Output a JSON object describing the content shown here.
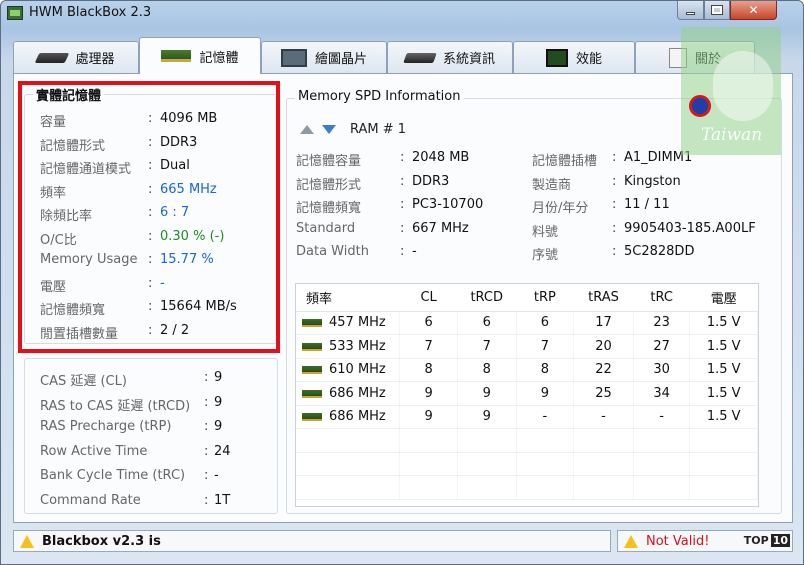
{
  "window": {
    "title": "HWM BlackBox 2.3"
  },
  "tabs": [
    {
      "label": "處理器",
      "icon": "cpu-icon"
    },
    {
      "label": "記憶體",
      "icon": "memory-icon"
    },
    {
      "label": "繪圖晶片",
      "icon": "gpu-icon"
    },
    {
      "label": "系統資訊",
      "icon": "system-info-icon"
    },
    {
      "label": "效能",
      "icon": "performance-icon"
    },
    {
      "label": "關於",
      "icon": "about-icon"
    }
  ],
  "physical_memory": {
    "title": "實體記憶體",
    "rows": [
      {
        "label": "容量",
        "value": "4096 MB",
        "color": "normal"
      },
      {
        "label": "記憶體形式",
        "value": "DDR3",
        "color": "normal"
      },
      {
        "label": "記憶體通道模式",
        "value": "Dual",
        "color": "normal"
      },
      {
        "label": "頻率",
        "value": "665 MHz",
        "color": "blue"
      },
      {
        "label": "除頻比率",
        "value": "6 : 7",
        "color": "blue"
      },
      {
        "label": "O/C比",
        "value": "0.30 % (-)",
        "color": "green"
      },
      {
        "label": "Memory Usage",
        "value": "15.77 %",
        "color": "blue"
      },
      {
        "label": "電壓",
        "value": "-",
        "color": "blue"
      },
      {
        "label": "記憶體頻寬",
        "value": "15664 MB/s",
        "color": "normal"
      },
      {
        "label": "閒置插槽數量",
        "value": "2  /  2",
        "color": "normal"
      }
    ]
  },
  "timings": {
    "rows": [
      {
        "label": "CAS 延遲 (CL)",
        "value": "9"
      },
      {
        "label": "RAS to CAS 延遲 (tRCD)",
        "value": "9"
      },
      {
        "label": "RAS Precharge (tRP)",
        "value": "9"
      },
      {
        "label": "Row Active Time",
        "value": "24"
      },
      {
        "label": "Bank Cycle Time (tRC)",
        "value": "-"
      },
      {
        "label": "Command Rate",
        "value": "1T"
      }
    ]
  },
  "spd": {
    "title": "Memory SPD Information",
    "ram_label": "RAM # 1",
    "left": [
      {
        "label": "記憶體容量",
        "value": "2048 MB"
      },
      {
        "label": "記憶體形式",
        "value": "DDR3"
      },
      {
        "label": "記憶體頻寬",
        "value": "PC3-10700"
      },
      {
        "label": "Standard",
        "value": "667 MHz"
      },
      {
        "label": "Data Width",
        "value": "-"
      }
    ],
    "right": [
      {
        "label": "記憶體插槽",
        "value": "A1_DIMM1"
      },
      {
        "label": "製造商",
        "value": "Kingston"
      },
      {
        "label": "月份/年分",
        "value": "11 / 11"
      },
      {
        "label": "料號",
        "value": "9905403-185.A00LF"
      },
      {
        "label": "序號",
        "value": "5C2828DD"
      }
    ],
    "table": {
      "headers": [
        "頻率",
        "CL",
        "tRCD",
        "tRP",
        "tRAS",
        "tRC",
        "電壓"
      ],
      "rows": [
        [
          "457 MHz",
          "6",
          "6",
          "6",
          "17",
          "23",
          "1.5 V"
        ],
        [
          "533 MHz",
          "7",
          "7",
          "7",
          "20",
          "27",
          "1.5 V"
        ],
        [
          "610 MHz",
          "8",
          "8",
          "8",
          "22",
          "30",
          "1.5 V"
        ],
        [
          "686 MHz",
          "9",
          "9",
          "9",
          "25",
          "34",
          "1.5 V"
        ],
        [
          "686 MHz",
          "9",
          "9",
          "-",
          "-",
          "-",
          "1.5 V"
        ]
      ]
    }
  },
  "status": {
    "left": "Blackbox v2.3 is",
    "right": "Not Valid!",
    "brand": "TOP",
    "brand_num": "10"
  },
  "watermark": {
    "text": "Taiwan"
  },
  "colors": {
    "highlight": "#e3101a",
    "blue_value": "#1a66cc",
    "green_value": "#1f8a2a"
  }
}
